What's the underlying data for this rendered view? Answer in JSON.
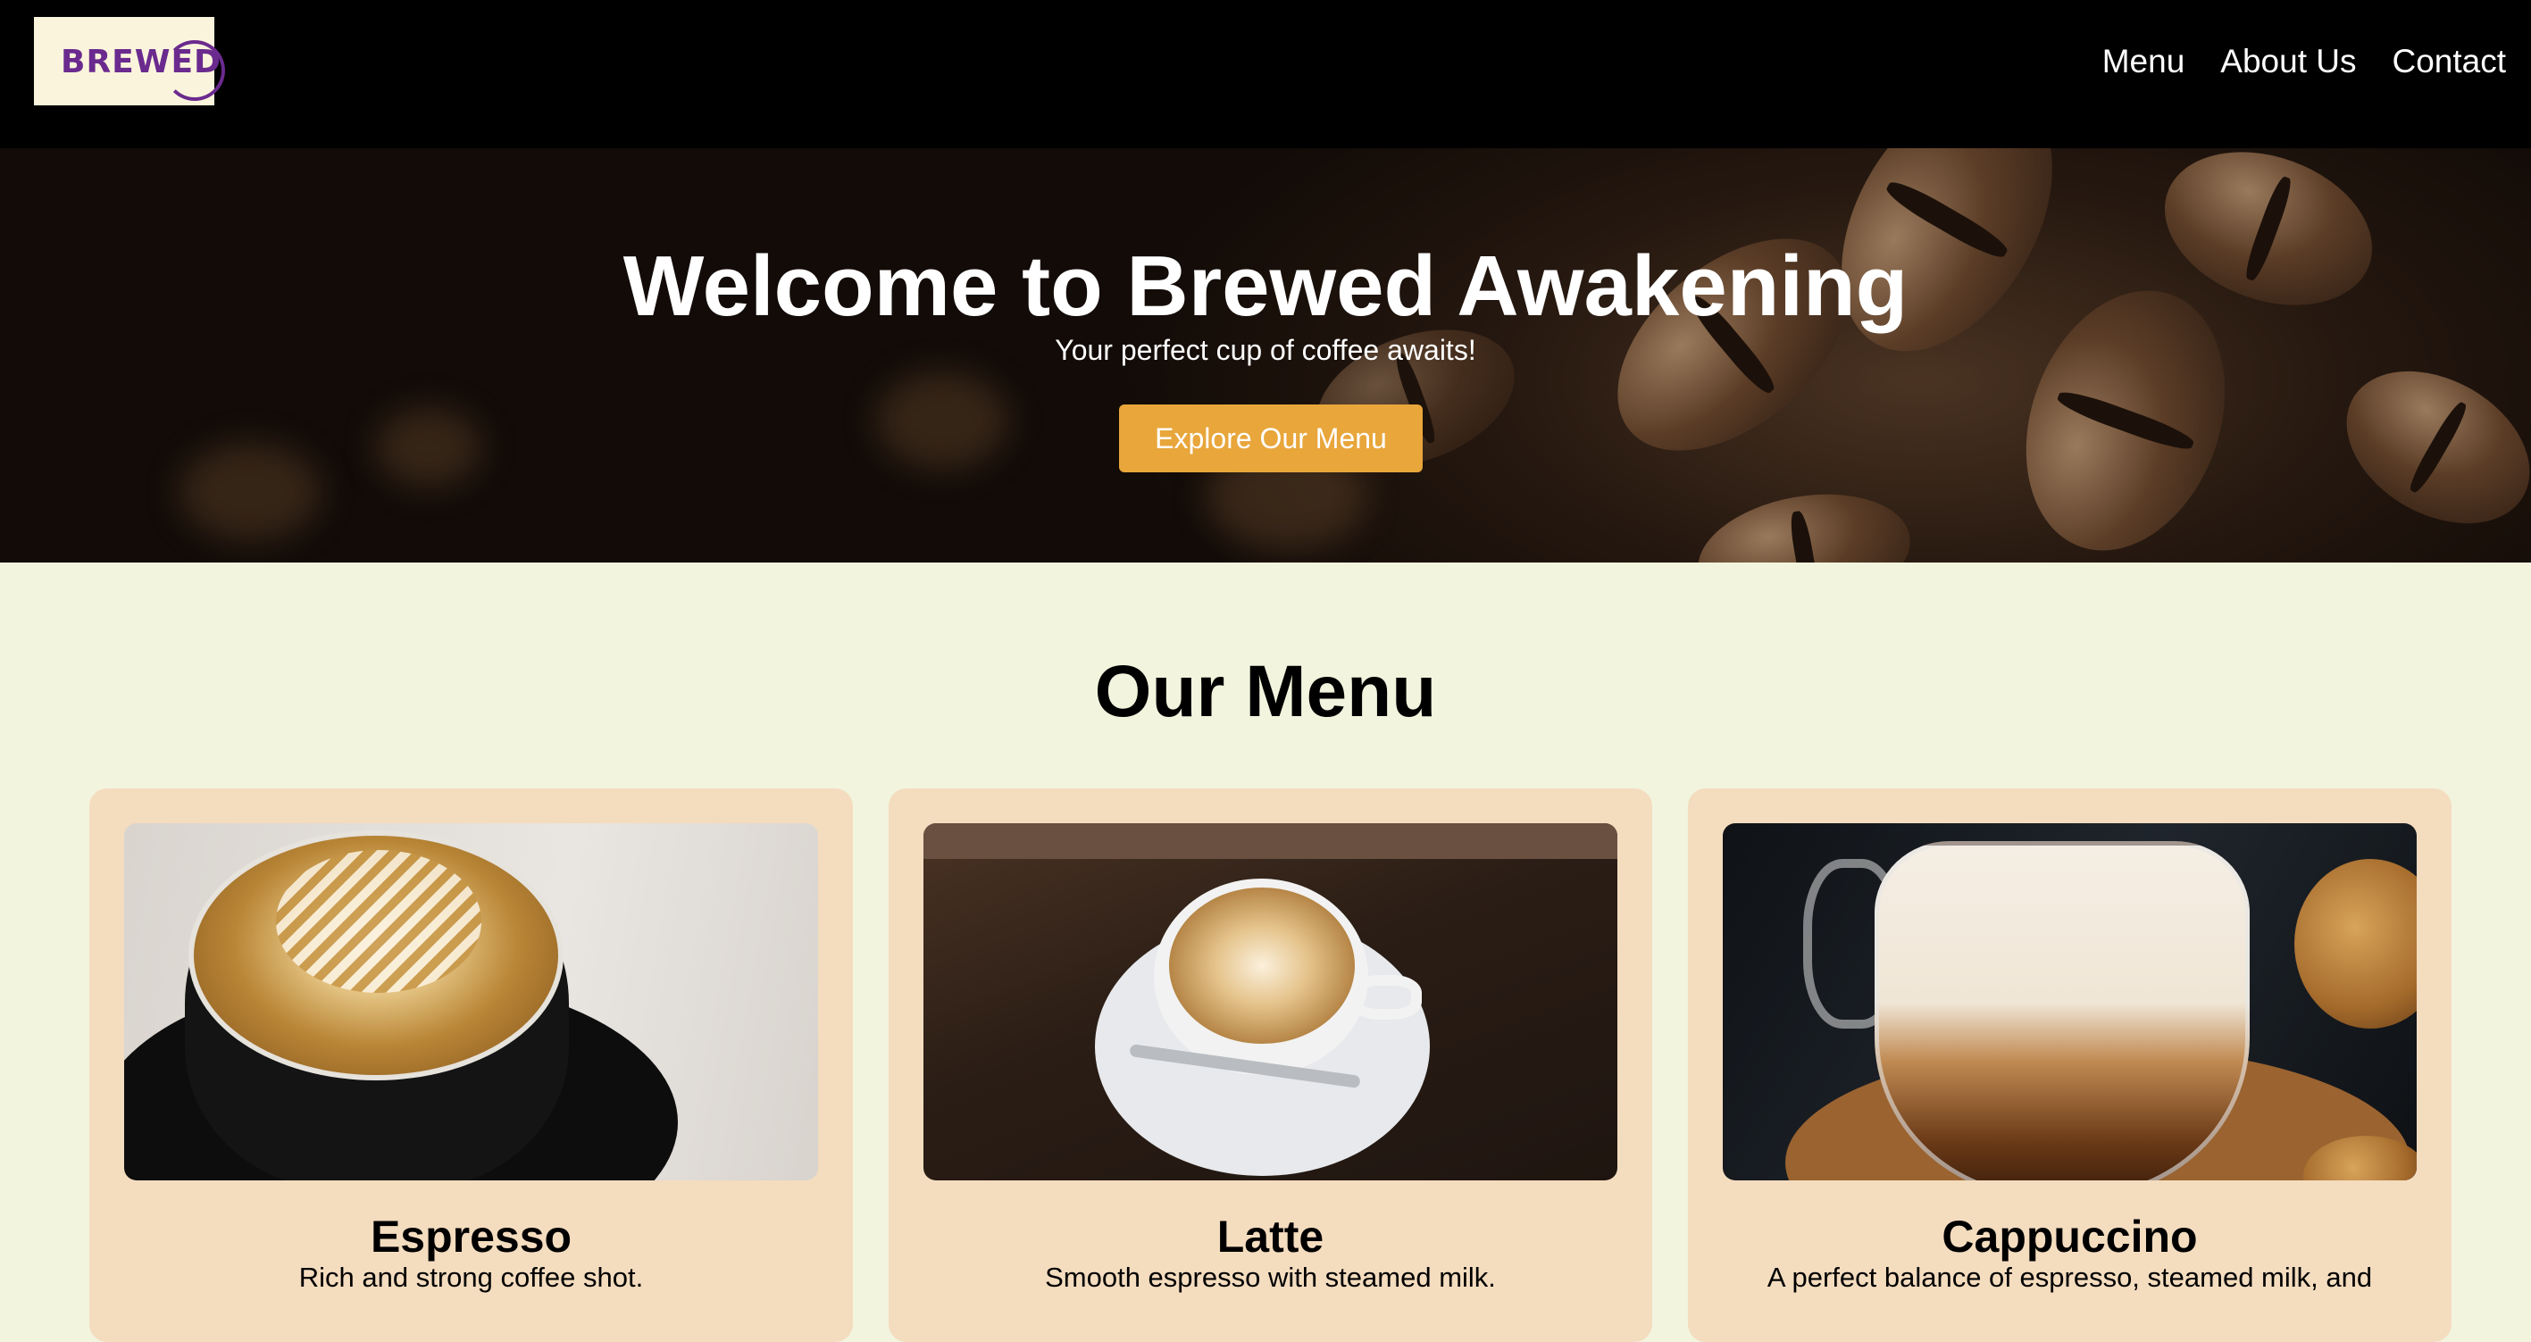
{
  "header": {
    "logo_text": "BREWED",
    "nav": [
      {
        "label": "Menu"
      },
      {
        "label": "About Us"
      },
      {
        "label": "Contact"
      }
    ]
  },
  "hero": {
    "title": "Welcome to Brewed Awakening",
    "subtitle": "Your perfect cup of coffee awaits!",
    "cta_label": "Explore Our Menu"
  },
  "menu": {
    "title": "Our Menu",
    "items": [
      {
        "name": "Espresso",
        "description": "Rich and strong coffee shot."
      },
      {
        "name": "Latte",
        "description": "Smooth espresso with steamed milk."
      },
      {
        "name": "Cappuccino",
        "description": "A perfect balance of espresso, steamed milk, and"
      }
    ]
  },
  "colors": {
    "header_bg": "#000000",
    "page_bg": "#f2f4de",
    "card_bg": "#f4dcbf",
    "accent": "#e8a63b",
    "logo_color": "#6a2a8e"
  }
}
